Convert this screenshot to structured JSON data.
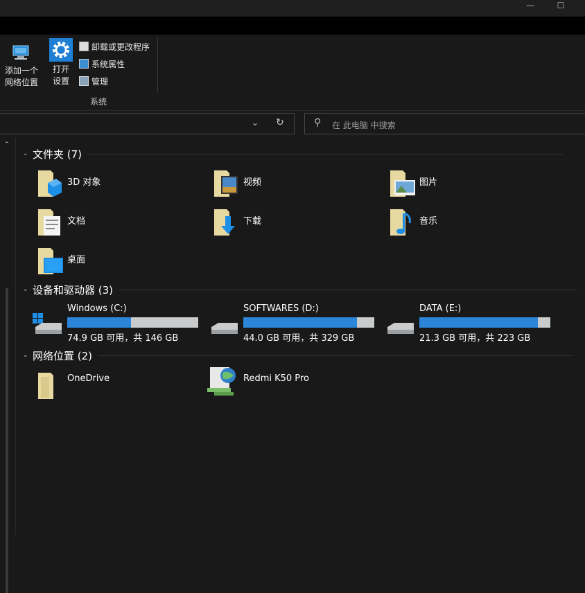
{
  "window": {
    "minimize_glyph": "—",
    "maximize_glyph": "☐",
    "collapse_ribbon_glyph": "⌃"
  },
  "ribbon": {
    "add_network_location": {
      "line1": "添加一个",
      "line2": "网络位置"
    },
    "open_settings": {
      "line1": "打开",
      "line2": "设置"
    },
    "uninstall": "卸载或更改程序",
    "system_properties": "系统属性",
    "manage": "管理",
    "group_label": "系统"
  },
  "address": {
    "dropdown_glyph": "⌄",
    "refresh_glyph": "↻"
  },
  "search": {
    "icon_glyph": "⚲",
    "placeholder": "在 此电脑 中搜索"
  },
  "nav": {
    "up_glyph": "⌃"
  },
  "sections": {
    "folders": {
      "title": "文件夹 (7)",
      "items": [
        "3D 对象",
        "视频",
        "图片",
        "文档",
        "下载",
        "音乐",
        "桌面"
      ]
    },
    "drives": {
      "title": "设备和驱动器 (3)",
      "items": [
        {
          "name": "Windows (C:)",
          "free": "74.9 GB 可用，共 146 GB",
          "used_fraction": 0.487
        },
        {
          "name": "SOFTWARES (D:)",
          "free": "44.0 GB 可用，共 329 GB",
          "used_fraction": 0.866
        },
        {
          "name": "DATA (E:)",
          "free": "21.3 GB 可用，共 223 GB",
          "used_fraction": 0.904
        }
      ]
    },
    "network": {
      "title": "网络位置 (2)",
      "items": [
        "OneDrive",
        "Redmi K50 Pro"
      ]
    }
  },
  "colors": {
    "background": "#191919",
    "bar_fill": "#2b86d9",
    "bar_track": "#c9cbcc",
    "folder": "#e8d9a0",
    "accent_blue": "#1e90ff"
  }
}
